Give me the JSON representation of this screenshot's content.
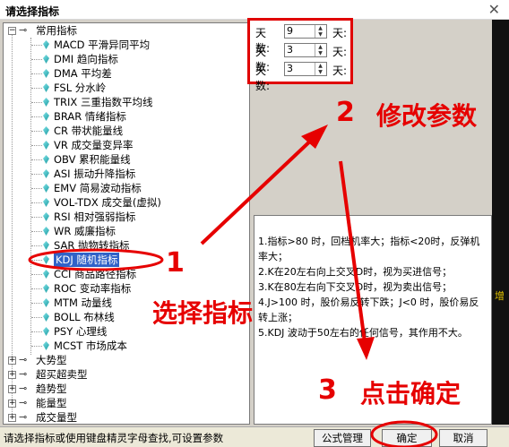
{
  "window": {
    "title": "请选择指标",
    "close_glyph": "✕"
  },
  "tree": {
    "root_label": "常用指标",
    "items": [
      {
        "code": "MACD",
        "name": "平滑异同平均"
      },
      {
        "code": "DMI",
        "name": "趋向指标"
      },
      {
        "code": "DMA",
        "name": "平均差"
      },
      {
        "code": "FSL",
        "name": "分水岭"
      },
      {
        "code": "TRIX",
        "name": "三重指数平均线"
      },
      {
        "code": "BRAR",
        "name": "情绪指标"
      },
      {
        "code": "CR",
        "name": "带状能量线"
      },
      {
        "code": "VR",
        "name": "成交量变异率"
      },
      {
        "code": "OBV",
        "name": "累积能量线"
      },
      {
        "code": "ASI",
        "name": "振动升降指标"
      },
      {
        "code": "EMV",
        "name": "简易波动指标"
      },
      {
        "code": "VOL-TDX",
        "name": "成交量(虚拟)"
      },
      {
        "code": "RSI",
        "name": "相对强弱指标"
      },
      {
        "code": "WR",
        "name": "威廉指标"
      },
      {
        "code": "SAR",
        "name": "抛物转指标"
      },
      {
        "code": "KDJ",
        "name": "随机指标"
      },
      {
        "code": "CCI",
        "name": "商品路径指标"
      },
      {
        "code": "ROC",
        "name": "变动率指标"
      },
      {
        "code": "MTM",
        "name": "动量线"
      },
      {
        "code": "BOLL",
        "name": "布林线"
      },
      {
        "code": "PSY",
        "name": "心理线"
      },
      {
        "code": "MCST",
        "name": "市场成本"
      }
    ],
    "selected_index": 15,
    "groups": [
      "大势型",
      "超买超卖型",
      "趋势型",
      "能量型",
      "成交量型"
    ]
  },
  "params": {
    "rows": [
      {
        "label": "天数:",
        "value": "9",
        "unit": "天:"
      },
      {
        "label": "天数:",
        "value": "3",
        "unit": "天:"
      },
      {
        "label": "天数:",
        "value": "3",
        "unit": "天:"
      }
    ]
  },
  "description": [
    "1.指标>80 时，回档机率大；指标<20时，反弹机率大；",
    "2.K在20左右向上交叉D时，视为买进信号；",
    "3.K在80左右向下交叉D时，视为卖出信号；",
    "4.J>100 时，股价易反转下跌；J<0 时，股价易反转上涨；",
    "5.KDJ 波动于50左右的任何信号，其作用不大。"
  ],
  "status": {
    "message": "请选择指标或使用键盘精灵字母查找,可设置参数",
    "formula_button": "公式管理",
    "ok_button": "确定",
    "cancel_button": "取消"
  },
  "annotations": {
    "step1_num": "1",
    "step1_text": "选择指标",
    "step2_num": "2",
    "step2_text": "修改参数",
    "step3_num": "3",
    "step3_text": "点击确定"
  },
  "side_label": "增"
}
